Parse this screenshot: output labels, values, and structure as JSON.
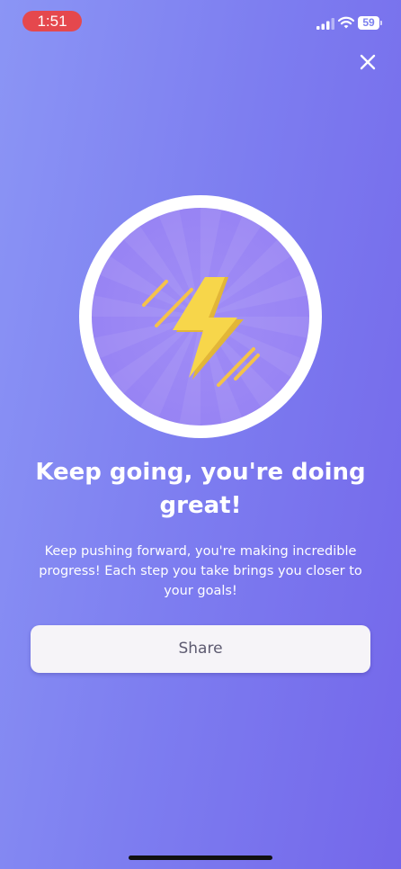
{
  "status_bar": {
    "time": "1:51",
    "battery_level": "59",
    "icons": [
      "signal-icon",
      "wifi-icon",
      "battery-icon"
    ],
    "time_pill_color": "#e5484d"
  },
  "header": {
    "close_icon": "close-icon"
  },
  "badge": {
    "icon": "lightning-bolt-icon",
    "ring_color": "#ffffff",
    "fill_color": "#9a86f4",
    "bolt_color": "#f7d64a"
  },
  "main": {
    "headline": "Keep going, you're doing great!",
    "description": "Keep pushing forward, you're making incredible progress! Each step you take brings you closer to your goals!",
    "share_label": "Share"
  },
  "colors": {
    "background_start": "#8b95f5",
    "background_end": "#7467ea",
    "button_background": "#f6f4f8",
    "button_text": "#5d5a70"
  }
}
